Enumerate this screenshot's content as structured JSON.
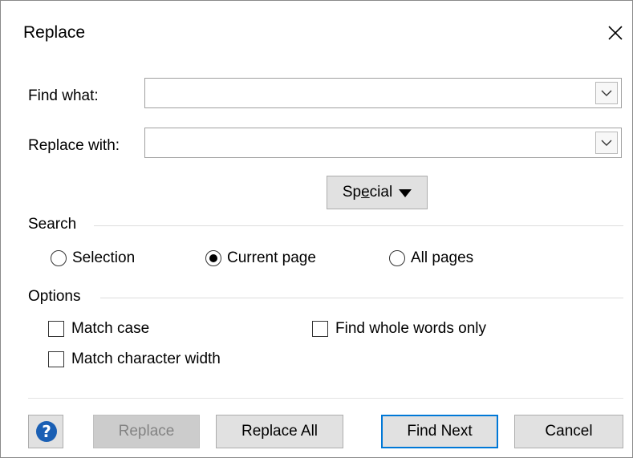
{
  "window": {
    "title": "Replace",
    "close_glyph": "✕"
  },
  "find": {
    "label_pre": "Find what:",
    "value": "",
    "placeholder": ""
  },
  "replace": {
    "label_pre": "Replace with:",
    "value": "",
    "placeholder": ""
  },
  "special_button": {
    "label_pre": "Sp",
    "label_underlined": "e",
    "label_post": "cial"
  },
  "search": {
    "label": "Search",
    "options": [
      {
        "label": "Selection",
        "checked": false
      },
      {
        "label": "Current page",
        "checked": true
      },
      {
        "label": "All pages",
        "checked": false
      }
    ]
  },
  "options": {
    "label": "Options",
    "checkboxes": [
      {
        "label": "Match case",
        "checked": false
      },
      {
        "label": "Find whole words only",
        "checked": false
      },
      {
        "label": "Match character width",
        "checked": false
      }
    ]
  },
  "footer": {
    "help_glyph": "?",
    "replace_label": "Replace",
    "replace_all_label": "Replace All",
    "find_next_label": "Find Next",
    "cancel_label": "Cancel"
  },
  "colors": {
    "accent": "#0078d7",
    "help_icon": "#1a5fb4",
    "button_bg": "#e1e1e1",
    "disabled_text": "#838383"
  }
}
